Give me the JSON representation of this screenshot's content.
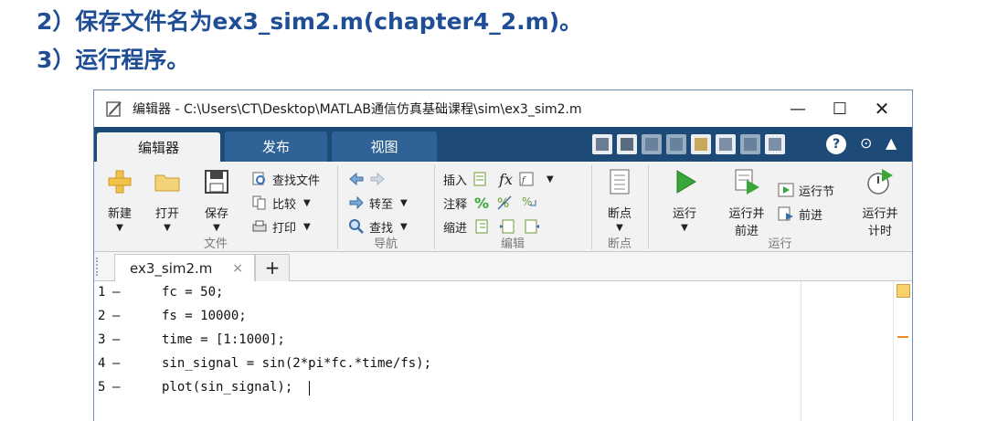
{
  "slide": {
    "line1": "2）保存文件名为ex3_sim2.m(chapter4_2.m)。",
    "line2": "3）运行程序。"
  },
  "window": {
    "title": "编辑器 - C:\\Users\\CT\\Desktop\\MATLAB通信仿真基础课程\\sim\\ex3_sim2.m",
    "minimize": "—",
    "maximize": "☐",
    "close": "✕"
  },
  "ribbon_tabs": [
    "编辑器",
    "发布",
    "视图"
  ],
  "ribbon": {
    "file": {
      "new": "新建",
      "open": "打开",
      "save": "保存",
      "find_files": "查找文件",
      "compare": "比较",
      "print": "打印",
      "group": "文件"
    },
    "nav": {
      "goto": "转至",
      "find": "查找",
      "group": "导航"
    },
    "edit": {
      "insert": "插入",
      "comment": "注释",
      "indent": "缩进",
      "fx": "fx",
      "percent": "%",
      "group": "编辑"
    },
    "breakpoints": {
      "breakpoints": "断点",
      "group": "断点"
    },
    "run": {
      "run": "运行",
      "run_advance_1": "运行并",
      "run_advance_2": "前进",
      "run_section": "运行节",
      "advance": "前进",
      "run_time_1": "运行并",
      "run_time_2": "计时",
      "group": "运行"
    }
  },
  "file_tab": {
    "name": "ex3_sim2.m",
    "close": "×",
    "add": "+"
  },
  "code_lines": [
    {
      "n": "1",
      "code": "fc = 50;"
    },
    {
      "n": "2",
      "code": "fs = 10000;"
    },
    {
      "n": "3",
      "code": "time = [1:1000];"
    },
    {
      "n": "4",
      "code": "sin_signal = sin(2*pi*fc.*time/fs);"
    },
    {
      "n": "5",
      "code": "plot(sin_signal);"
    }
  ],
  "colors": {
    "slide_text": "#1f4e96",
    "tabstrip": "#1d4a77",
    "run_green": "#3aa63a"
  }
}
